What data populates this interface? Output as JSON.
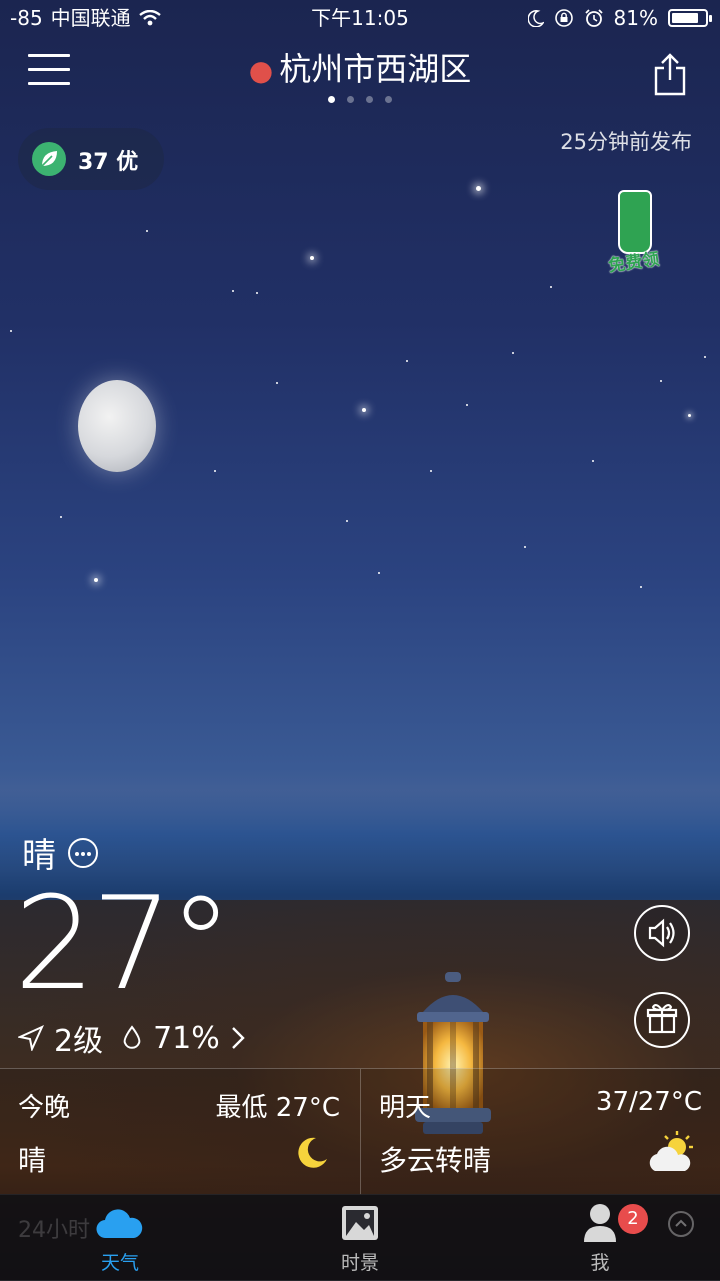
{
  "status_bar": {
    "signal": "-85",
    "carrier": "中国联通",
    "time": "下午11:05",
    "battery_percent": "81%",
    "battery_level": 0.81
  },
  "header": {
    "location": "杭州市西湖区",
    "page_count": 4,
    "active_page": 1
  },
  "air_quality": {
    "value": "37 优",
    "color": "#3cb371"
  },
  "publish_time": "25分钟前发布",
  "promo": {
    "label": "免费领"
  },
  "current": {
    "condition": "晴",
    "temperature": "27°",
    "wind": "2级",
    "humidity": "71%"
  },
  "forecast": {
    "tonight": {
      "label": "今晚",
      "temp": "最低 27°C",
      "desc": "晴",
      "icon": "moon-icon"
    },
    "tomorrow": {
      "label": "明天",
      "temp": "37/27°C",
      "desc": "多云转晴",
      "icon": "partly-cloudy-icon"
    }
  },
  "hourly_hint": "24小时",
  "tabs": [
    {
      "label": "天气",
      "icon": "cloud-icon",
      "active": true
    },
    {
      "label": "时景",
      "icon": "photo-icon",
      "active": false
    },
    {
      "label": "我",
      "icon": "user-icon",
      "active": false
    }
  ],
  "me_badge": "2",
  "colors": {
    "accent": "#29a0f0",
    "pin": "#e0504a",
    "badge": "#e84c4c"
  }
}
